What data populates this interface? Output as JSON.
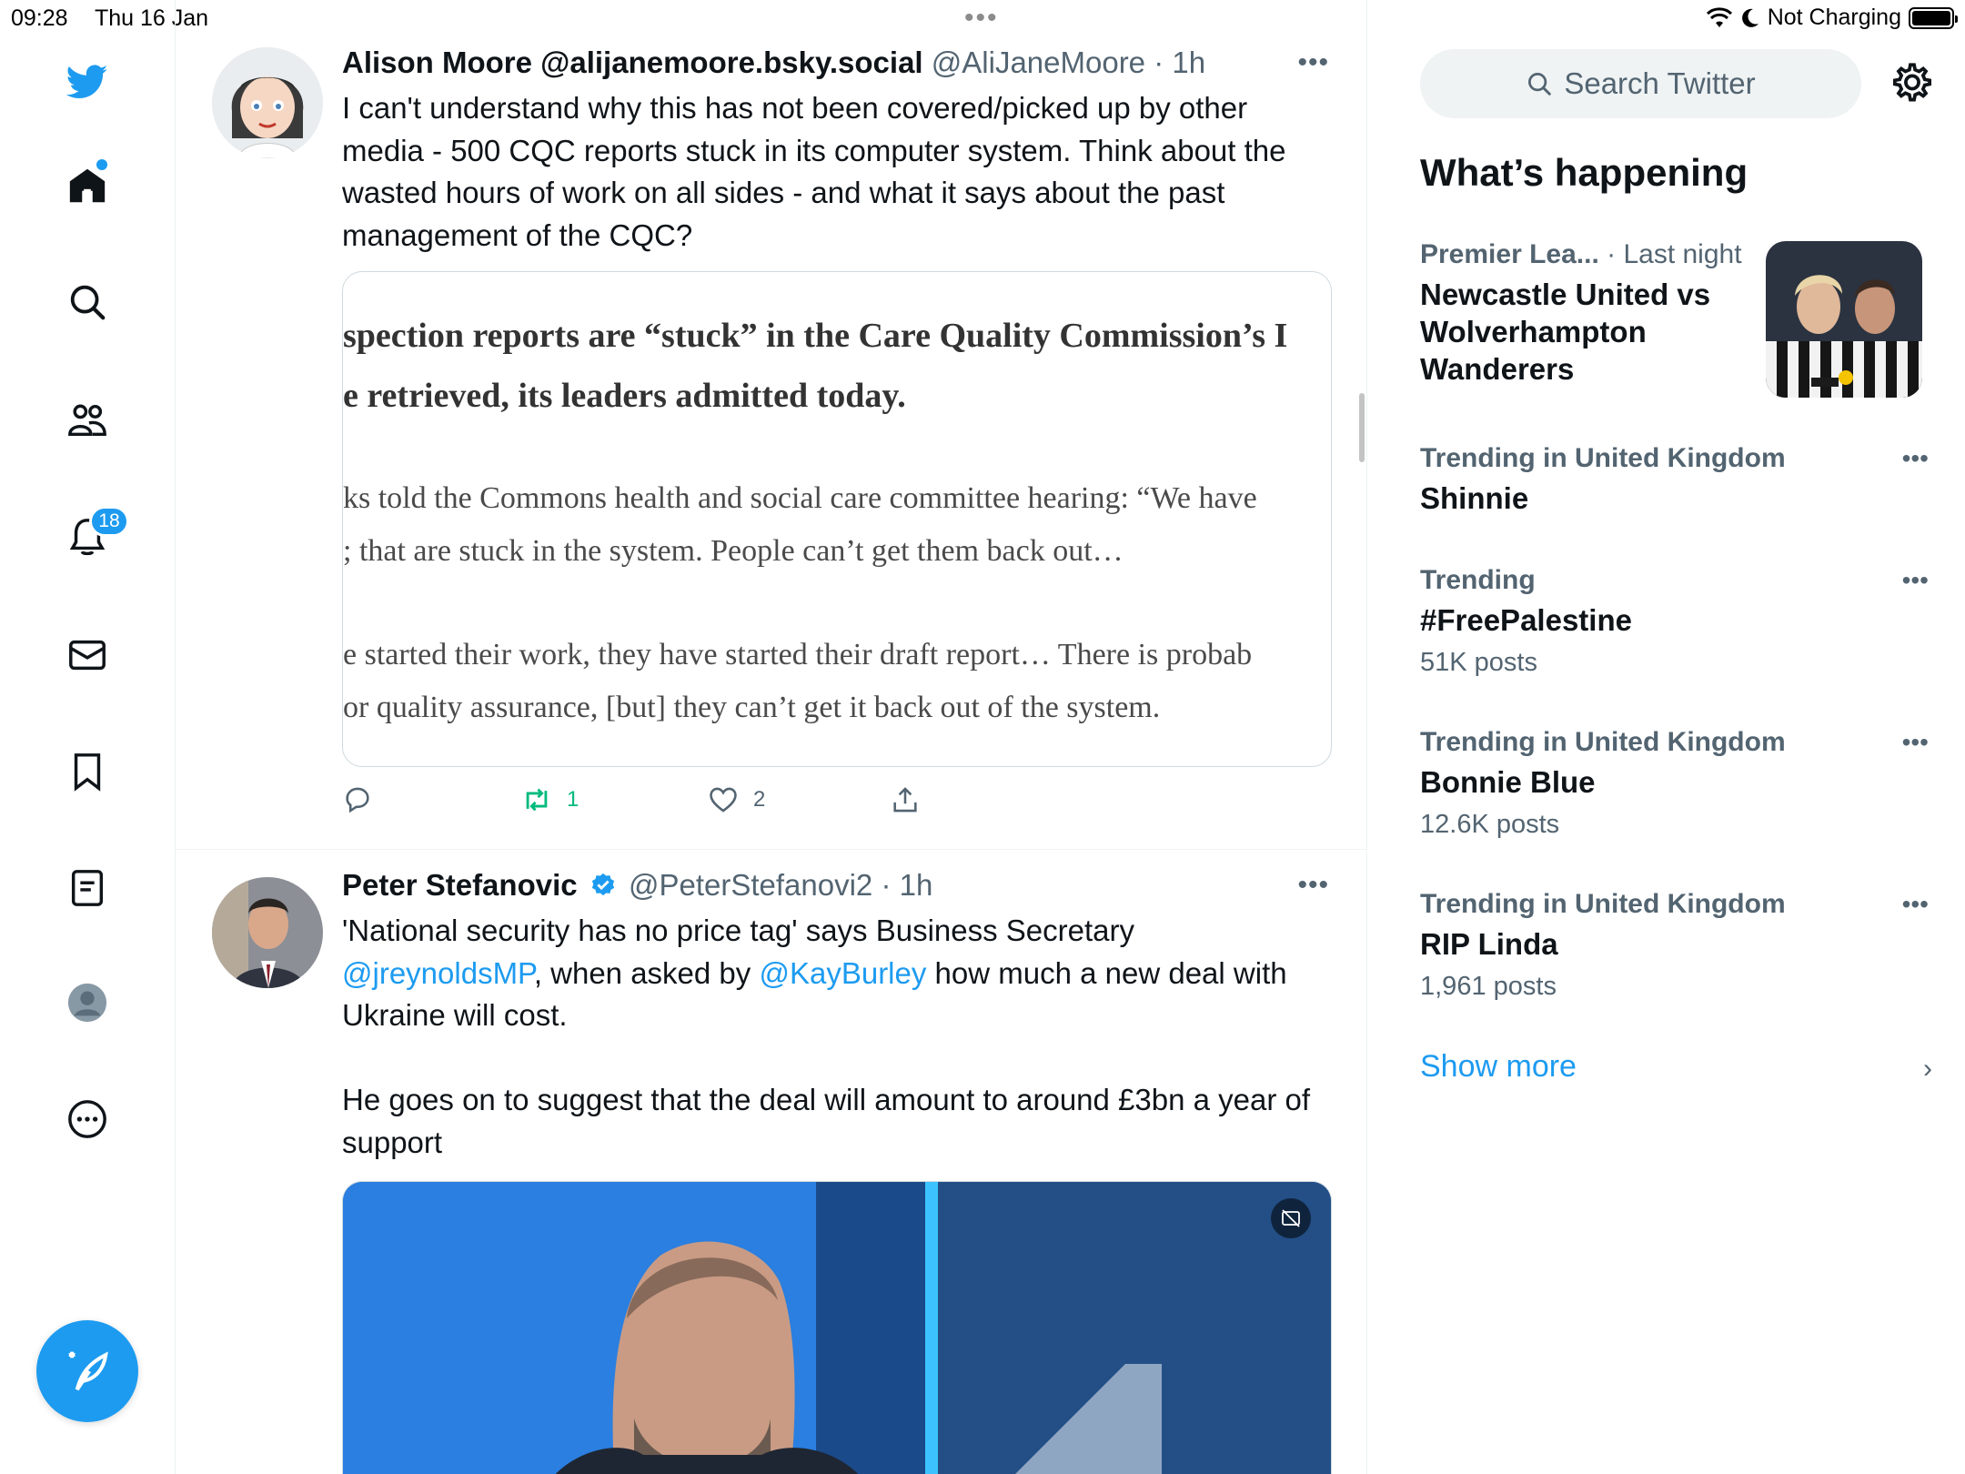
{
  "status_bar": {
    "time": "09:28",
    "date": "Thu 16 Jan",
    "charging": "Not Charging"
  },
  "nav": {
    "notifications_badge": "18",
    "items": [
      "twitter-logo",
      "home-icon",
      "search-icon",
      "communities-icon",
      "notifications-icon",
      "messages-icon",
      "bookmarks-icon",
      "lists-icon",
      "profile-icon",
      "more-icon"
    ]
  },
  "tweets": [
    {
      "name": "Alison Moore @alijanemoore.bsky.social",
      "handle": "@AliJaneMoore",
      "time": "· 1h",
      "text": "I can't understand why this has not been covered/picked up by other media - 500 CQC reports stuck in its computer system. Think about the wasted hours of work on all sides - and what it says about the past management of the CQC?",
      "quote_lines": [
        "spection reports are “stuck” in the Care Quality Commission’s I",
        "e retrieved, its leaders admitted today.",
        "ks told the Commons health and social care committee hearing: “We have",
        "; that are stuck in the system. People can’t get them back out…",
        "e started their work, they have started their draft report… There is probab",
        "or quality assurance, [but] they can’t get it back out of the system."
      ],
      "retweets": "1",
      "likes": "2"
    },
    {
      "name": "Peter Stefanovic",
      "handle": "@PeterStefanovi2",
      "time": "· 1h",
      "text_part1": "'National security has no price tag' says Business Secretary ",
      "mention1": "@jreynoldsMP",
      "text_part2": ", when asked by ",
      "mention2": "@KayBurley",
      "text_part3": " how much a new deal with Ukraine will cost.",
      "text_para2": "He goes on to suggest that the deal will amount to around £3bn a year of support"
    }
  ],
  "sidebar": {
    "search_placeholder": "Search Twitter",
    "section_title": "What’s happening",
    "trends": [
      {
        "category": "Premier Lea...",
        "meta": "· Last night",
        "title": "Newcastle United vs Wolverhampton Wanderers",
        "posts": ""
      },
      {
        "category": "Trending in United Kingdom",
        "meta": "",
        "title": "Shinnie",
        "posts": ""
      },
      {
        "category": "Trending",
        "meta": "",
        "title": "#FreePalestine",
        "posts": "51K posts"
      },
      {
        "category": "Trending in United Kingdom",
        "meta": "",
        "title": "Bonnie Blue",
        "posts": "12.6K posts"
      },
      {
        "category": "Trending in United Kingdom",
        "meta": "",
        "title": "RIP Linda",
        "posts": "1,961 posts"
      }
    ],
    "show_more": "Show more"
  },
  "colors": {
    "accent": "#1d9bf0",
    "retweet_active": "#00ba7c",
    "text_primary": "#0f1419",
    "text_secondary": "#536471"
  }
}
